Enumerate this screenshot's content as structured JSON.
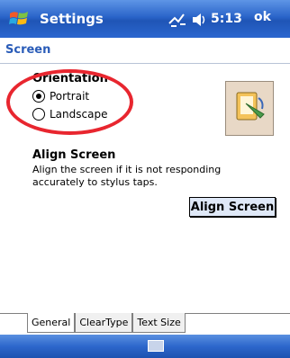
{
  "titlebar": {
    "title": "Settings",
    "clock": "5:13",
    "ok_label": "ok"
  },
  "screen": {
    "title": "Screen"
  },
  "orientation": {
    "heading": "Orientation",
    "options": [
      {
        "label": "Portrait",
        "selected": true
      },
      {
        "label": "Landscape",
        "selected": false
      }
    ]
  },
  "align": {
    "heading": "Align Screen",
    "description": "Align the screen if it is not responding accurately to stylus taps.",
    "button_label": "Align Screen"
  },
  "tabs": [
    {
      "label": "General",
      "active": true
    },
    {
      "label": "ClearType",
      "active": false
    },
    {
      "label": "Text Size",
      "active": false
    }
  ],
  "colors": {
    "titlebar_blue": "#2a64c9",
    "accent_title": "#2a5cb8",
    "highlight_circle": "#e8262f"
  },
  "icons": {
    "start": "windows-flag-icon",
    "signal": "connectivity-icon",
    "volume": "volume-icon",
    "orientation_preview": "screen-rotation-icon",
    "keyboard": "keyboard-icon"
  }
}
